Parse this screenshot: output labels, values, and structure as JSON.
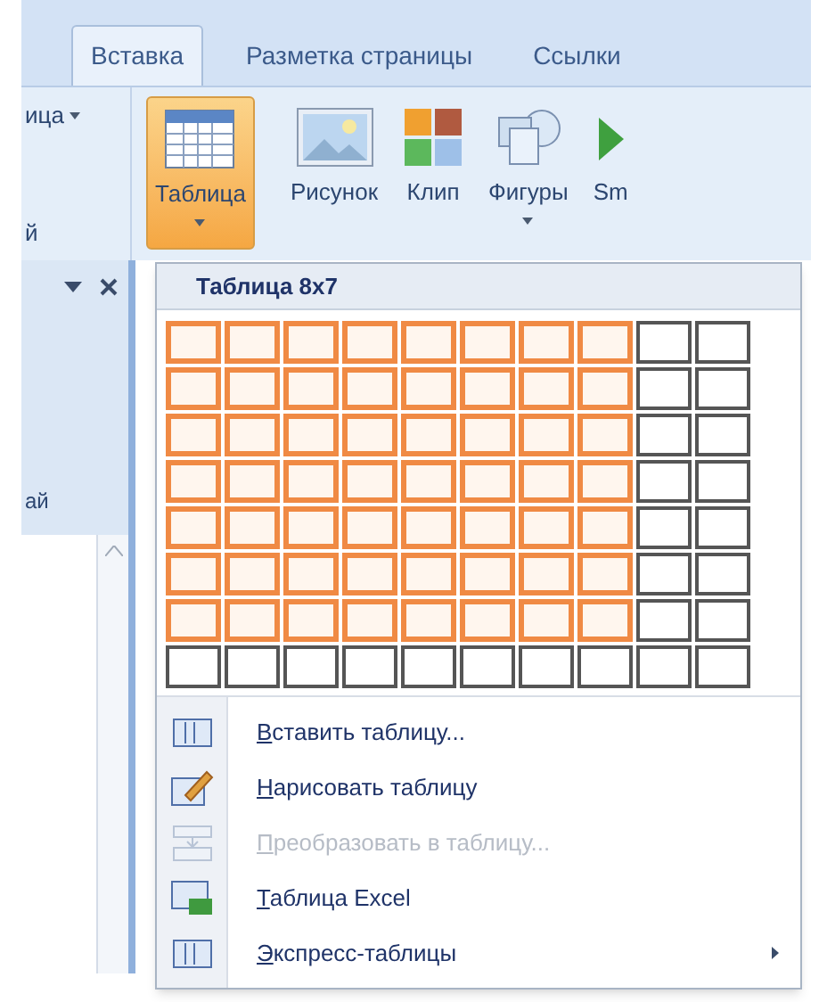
{
  "tabs": [
    {
      "label": "Вставка",
      "selected": true
    },
    {
      "label": "Разметка страницы",
      "selected": false
    },
    {
      "label": "Ссылки",
      "selected": false
    }
  ],
  "ribbon": {
    "left_group": {
      "label": "ица",
      "has_dropdown": true,
      "bottom_text": "й"
    },
    "buttons": [
      {
        "kind": "table",
        "label": "Таблица",
        "selected": true,
        "has_dropdown": true
      },
      {
        "kind": "picture",
        "label": "Рисунок",
        "selected": false,
        "has_dropdown": false
      },
      {
        "kind": "clip",
        "label": "Клип",
        "selected": false,
        "has_dropdown": false
      },
      {
        "kind": "shapes",
        "label": "Фигуры",
        "selected": false,
        "has_dropdown": true
      },
      {
        "kind": "smartart",
        "label": "Sm",
        "selected": false,
        "has_dropdown": false
      }
    ]
  },
  "side_pane": {
    "text": "ай"
  },
  "table_menu": {
    "title": "Таблица 8x7",
    "grid": [
      {
        "cells": [
          {
            "selected": true
          },
          {
            "selected": true
          },
          {
            "selected": true
          },
          {
            "selected": true
          },
          {
            "selected": true
          },
          {
            "selected": true
          },
          {
            "selected": true
          },
          {
            "selected": true
          },
          {
            "selected": false
          },
          {
            "selected": false
          }
        ]
      },
      {
        "cells": [
          {
            "selected": true
          },
          {
            "selected": true
          },
          {
            "selected": true
          },
          {
            "selected": true
          },
          {
            "selected": true
          },
          {
            "selected": true
          },
          {
            "selected": true
          },
          {
            "selected": true
          },
          {
            "selected": false
          },
          {
            "selected": false
          }
        ]
      },
      {
        "cells": [
          {
            "selected": true
          },
          {
            "selected": true
          },
          {
            "selected": true
          },
          {
            "selected": true
          },
          {
            "selected": true
          },
          {
            "selected": true
          },
          {
            "selected": true
          },
          {
            "selected": true
          },
          {
            "selected": false
          },
          {
            "selected": false
          }
        ]
      },
      {
        "cells": [
          {
            "selected": true
          },
          {
            "selected": true
          },
          {
            "selected": true
          },
          {
            "selected": true
          },
          {
            "selected": true
          },
          {
            "selected": true
          },
          {
            "selected": true
          },
          {
            "selected": true
          },
          {
            "selected": false
          },
          {
            "selected": false
          }
        ]
      },
      {
        "cells": [
          {
            "selected": true
          },
          {
            "selected": true
          },
          {
            "selected": true
          },
          {
            "selected": true
          },
          {
            "selected": true
          },
          {
            "selected": true
          },
          {
            "selected": true
          },
          {
            "selected": true
          },
          {
            "selected": false
          },
          {
            "selected": false
          }
        ]
      },
      {
        "cells": [
          {
            "selected": true
          },
          {
            "selected": true
          },
          {
            "selected": true
          },
          {
            "selected": true
          },
          {
            "selected": true
          },
          {
            "selected": true
          },
          {
            "selected": true
          },
          {
            "selected": true
          },
          {
            "selected": false
          },
          {
            "selected": false
          }
        ]
      },
      {
        "cells": [
          {
            "selected": true
          },
          {
            "selected": true
          },
          {
            "selected": true
          },
          {
            "selected": true
          },
          {
            "selected": true
          },
          {
            "selected": true
          },
          {
            "selected": true
          },
          {
            "selected": true
          },
          {
            "selected": false
          },
          {
            "selected": false
          }
        ]
      },
      {
        "cells": [
          {
            "selected": false
          },
          {
            "selected": false
          },
          {
            "selected": false
          },
          {
            "selected": false
          },
          {
            "selected": false
          },
          {
            "selected": false
          },
          {
            "selected": false
          },
          {
            "selected": false
          },
          {
            "selected": false
          },
          {
            "selected": false
          }
        ]
      }
    ],
    "items": [
      {
        "kind": "insert",
        "label": "Вставить таблицу...",
        "disabled": false,
        "has_submenu": false
      },
      {
        "kind": "draw",
        "label": "Нарисовать таблицу",
        "disabled": false,
        "has_submenu": false
      },
      {
        "kind": "convert",
        "label": "Преобразовать в таблицу...",
        "disabled": true,
        "has_submenu": false
      },
      {
        "kind": "excel",
        "label": "Таблица Excel",
        "disabled": false,
        "has_submenu": false
      },
      {
        "kind": "quick",
        "label": "Экспресс-таблицы",
        "disabled": false,
        "has_submenu": true
      }
    ]
  }
}
